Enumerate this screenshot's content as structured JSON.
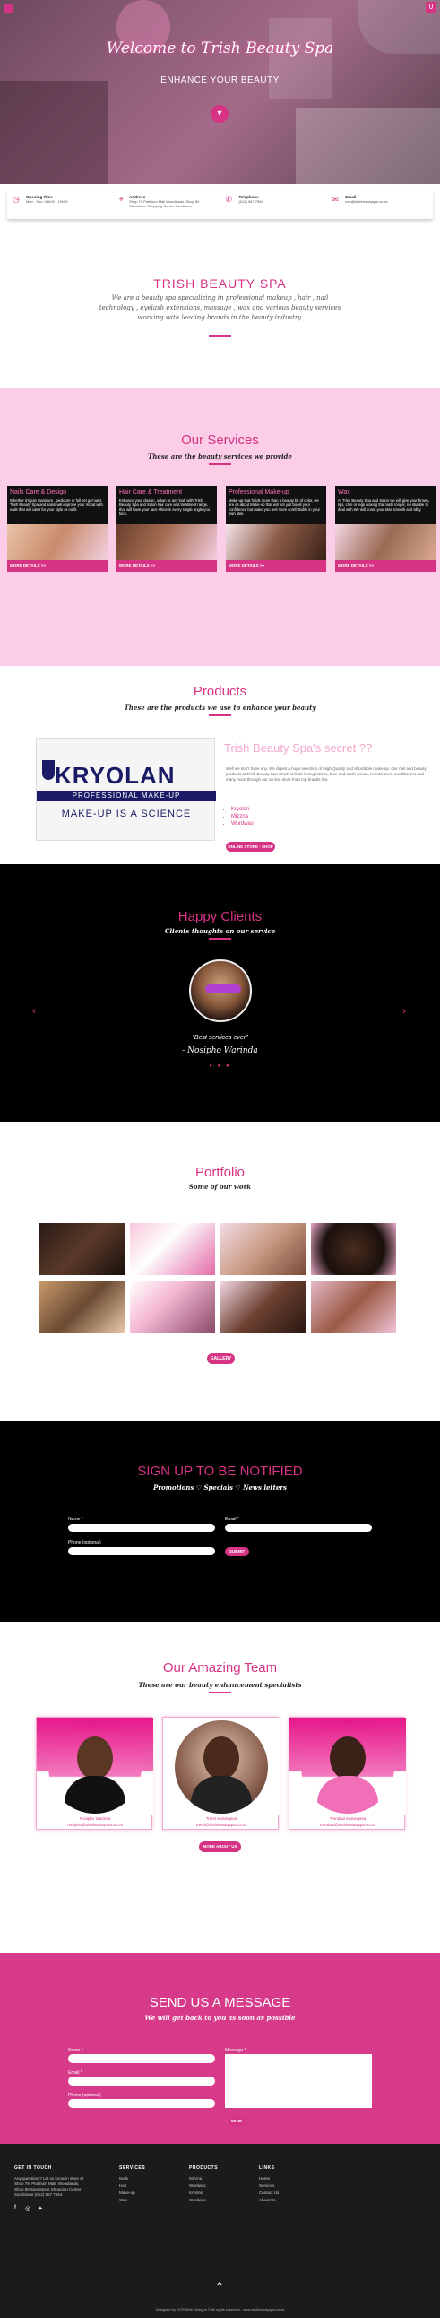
{
  "hero": {
    "title": "Welcome to Trish Beauty Spa",
    "subtitle": "ENHANCE YOUR BEAUTY",
    "scroll_icon": "chevron-down-icon",
    "cart_count": "0"
  },
  "info": [
    {
      "label": "Opening Time",
      "value": "Mon - Sun: 08h00 - 19h00",
      "icon": "clock-icon"
    },
    {
      "label": "Address",
      "value": "Shop 79 Platinum Mall Woodlands, Shop 80 Sandstone Shopping Center Sandstone",
      "icon": "location-icon"
    },
    {
      "label": "Telephone",
      "value": "(012) 567 7554",
      "icon": "phone-icon"
    },
    {
      "label": "Email",
      "value": "info@trishbeautyspa.co.za",
      "icon": "mail-icon"
    }
  ],
  "about": {
    "title": "TRISH BEAUTY SPA",
    "text": "We are a beauty spa specializing in professional makeup , hair , nail technology , eyelash extensions, massage , wax and various beauty services working with leading brands in the beauty industry."
  },
  "services": {
    "title": "Our Services",
    "subtitle": "These are the beauty services we provide",
    "items": [
      {
        "title": "Nails Care & Design",
        "text": "Whether it's just manicure , pedicure or full set gel nails. Trish Beauty Spa and salon will improve your mood with nails that will cater for your style or outfit.",
        "button": "MORE DETAILS >>"
      },
      {
        "title": "Hair Care & Treatment",
        "text": "Enhance your classic, urban or any look with Trish Beauty Spa and Salon hair care and treatment range, that will have your face shine in every single angle you face.",
        "button": "MORE DETAILS >>"
      },
      {
        "title": "Professional Make-up",
        "text": "Make-up that holds more than a beauty bit of color, we are all about Make-up that will not just boost your confidence but make you feel more comfortable in your own skin.",
        "button": "MORE DETAILS >>"
      },
      {
        "title": "Wax",
        "text": "At Trish Beauty Spa and Salon we will give your brows, lips, chin or legs waxing that lasts longer, no stubble to deal with.We will boost your skin smooth and silky.",
        "button": "MORE DETAILS >>"
      }
    ]
  },
  "products": {
    "title": "Products",
    "subtitle": "These are the products we use to enhance your beauty",
    "brand_word": "KRYOLAN",
    "brand_bar": "PROFESSIONAL MAKE-UP",
    "brand_tag": "MAKE-UP IS A SCIENCE",
    "secret_title": "Trish Beauty Spa's secret ??",
    "secret_text": "Well we don't have any. We digest a huge selection of High-Quality and affordable make-up. Our nail and beauty products at Trish Beauty Spa which include loving lotions, face and wash cream, moisturizers, conditioners and many more through our on-line store from top brands like",
    "list": [
      "Kryolan",
      "Mizzna",
      "Wordwas"
    ],
    "button": "ONLINE STORE - SHOP"
  },
  "clients": {
    "title": "Happy Clients",
    "subtitle": "Clients thoughts on our service",
    "quote": "\"Best services ever\"",
    "name": "- Nosipho Warinda",
    "dots": "● ● ●"
  },
  "portfolio": {
    "title": "Portfolio",
    "subtitle": "Some of our work",
    "button": "GALLERY"
  },
  "signup": {
    "title": "SIGN UP TO BE NOTIFIED",
    "subtitle": "Promotions ♡ Specials ♡ News letters",
    "name_label": "Name *",
    "email_label": "Email *",
    "phone_label": "Phone (optional)",
    "button": "SUBMIT"
  },
  "team": {
    "title": "Our Amazing Team",
    "subtitle": "These are our beauty enhancement specialists",
    "members": [
      {
        "name": "Nosipho Warinda",
        "email": "nosipho@trishbeautyspa.co.za"
      },
      {
        "name": "Tremi Mulungasa",
        "email": "tremi@trishbeautyspa.co.za"
      },
      {
        "name": "Trendasi Mulungasa",
        "email": "trendasi@trishbeautyspa.co.za"
      }
    ],
    "button": "MORE ABOUT US"
  },
  "message": {
    "title": "SEND US A MESSAGE",
    "subtitle": "We will get back to you as soon as possible",
    "name_label": "Name *",
    "email_label": "Email *",
    "phone_label": "Phone (optional)",
    "message_label": "Message *",
    "button": "SEND"
  },
  "footer": {
    "getintouch_head": "GET IN TOUCH",
    "getintouch_text": "Any questions? Let us know in store at Shop 79, Platinum Mall, Woodlands, Shop 80 Sandstone Shopping Center Sandstone (012) 567 7554",
    "services_head": "SERVICES",
    "services_links": [
      "Nails",
      "Hair",
      "Make-up",
      "Wax"
    ],
    "products_head": "PRODUCTS",
    "products_links": [
      "Mizzna",
      "Wordwas",
      "Kryolan",
      "Wordwas"
    ],
    "links_head": "LINKS",
    "links_links": [
      "Home",
      "Services",
      "Contact Us",
      "About Us"
    ],
    "copyright": "Designed by OCR Web Designs © All rights reserved - www.trishbeautyspa.co.za"
  },
  "colors": {
    "accent": "#d63384",
    "services_bg": "#fccde6",
    "dark": "#000000",
    "message_bg": "#d63a88"
  }
}
